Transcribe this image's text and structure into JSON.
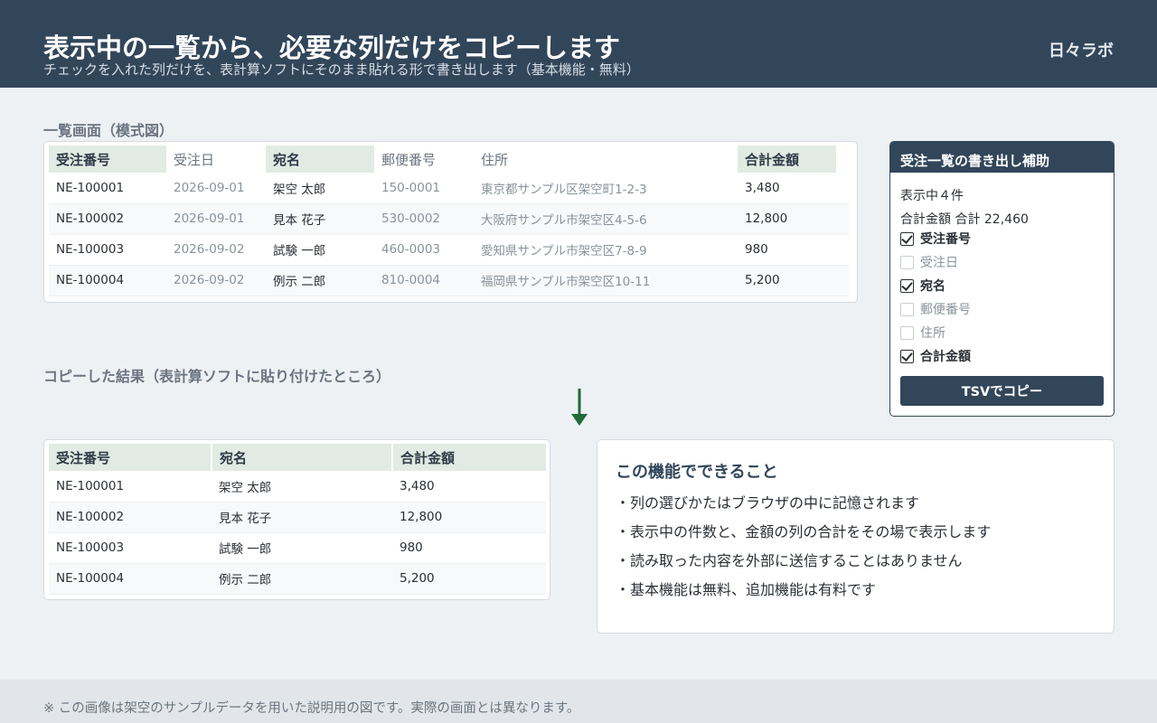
{
  "header": {
    "title": "表示中の一覧から、必要な列だけをコピーします",
    "subtitle": "チェックを入れた列だけを、表計算ソフトにそのまま貼れる形で書き出します（基本機能・無料）",
    "brand": "日々ラボ"
  },
  "list": {
    "label": "一覧画面（模式図）",
    "columns": [
      "受注番号",
      "受注日",
      "宛名",
      "郵便番号",
      "住所",
      "合計金額"
    ],
    "rows": [
      [
        "NE-100001",
        "2026-09-01",
        "架空 太郎",
        "150-0001",
        "東京都サンプル区架空町1-2-3",
        "3,480"
      ],
      [
        "NE-100002",
        "2026-09-01",
        "見本 花子",
        "530-0002",
        "大阪府サンプル市架空区4-5-6",
        "12,800"
      ],
      [
        "NE-100003",
        "2026-09-02",
        "試験 一郎",
        "460-0003",
        "愛知県サンプル市架空区7-8-9",
        "980"
      ],
      [
        "NE-100004",
        "2026-09-02",
        "例示 二郎",
        "810-0004",
        "福岡県サンプル市架空区10-11",
        "5,200"
      ]
    ]
  },
  "result": {
    "label": "コピーした結果（表計算ソフトに貼り付けたところ）",
    "columns": [
      "受注番号",
      "宛名",
      "合計金額"
    ],
    "rows": [
      [
        "NE-100001",
        "架空 太郎",
        "3,480"
      ],
      [
        "NE-100002",
        "見本 花子",
        "12,800"
      ],
      [
        "NE-100003",
        "試験 一郎",
        "980"
      ],
      [
        "NE-100004",
        "例示 二郎",
        "5,200"
      ]
    ]
  },
  "helper": {
    "title": "受注一覧の書き出し補助",
    "count_text": "表示中４件",
    "total_text": "合計金額 合計 22,460",
    "options": [
      {
        "label": "受注番号",
        "checked": true
      },
      {
        "label": "受注日",
        "checked": false
      },
      {
        "label": "宛名",
        "checked": true
      },
      {
        "label": "郵便番号",
        "checked": false
      },
      {
        "label": "住所",
        "checked": false
      },
      {
        "label": "合計金額",
        "checked": true
      }
    ],
    "button_label": "TSVでコピー"
  },
  "features": {
    "title": "この機能でできること",
    "items": [
      "・列の選びかたはブラウザの中に記憶されます",
      "・表示中の件数と、金額の列の合計をその場で表示します",
      "・読み取った内容を外部に送信することはありません",
      "・基本機能は無料、追加機能は有料です"
    ]
  },
  "footer": {
    "note": "※ この画像は架空のサンプルデータを用いた説明用の図です。実際の画面とは異なります。"
  },
  "colors": {
    "header_bg": "#32465a",
    "selected_column_bg": "#e1ebe3",
    "arrow": "#1f6b3a"
  }
}
